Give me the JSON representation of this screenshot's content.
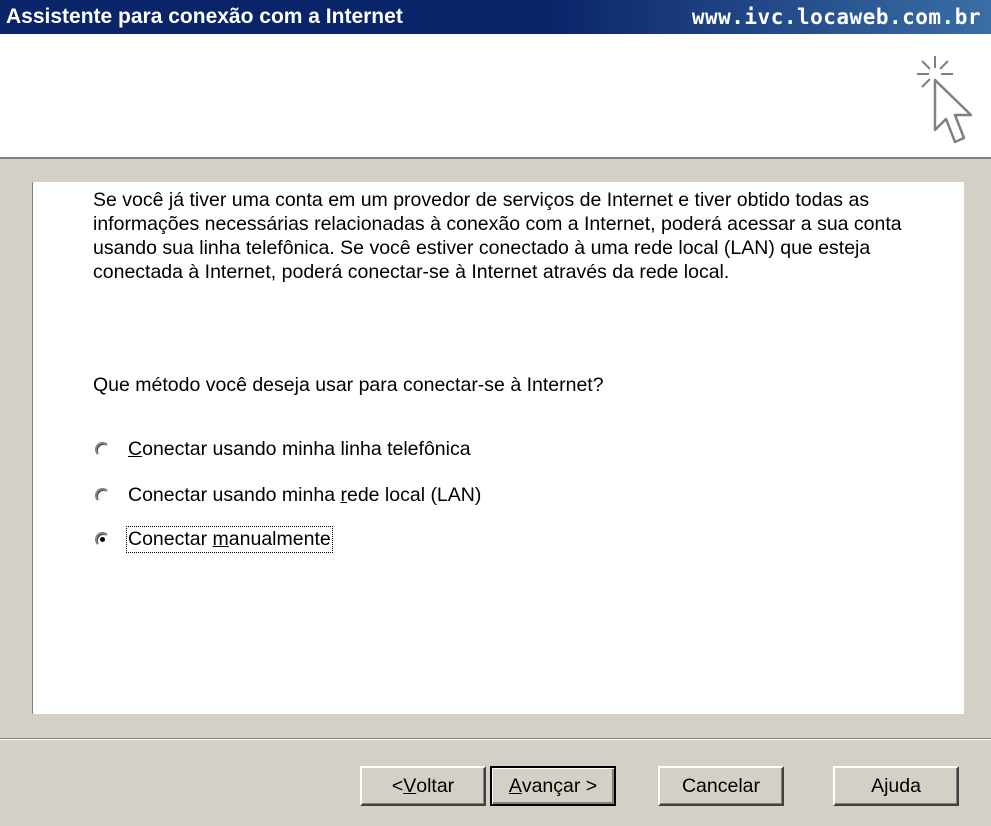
{
  "window": {
    "title": "Assistente para conexão com a Internet",
    "url": "www.ivc.locaweb.com.br"
  },
  "header": {
    "icon": "wizard-pointer-icon"
  },
  "content": {
    "intro": "Se você já tiver uma conta em um provedor de serviços de Internet e tiver obtido todas as informações necessárias relacionadas à conexão com a  Internet, poderá acessar a sua conta usando sua linha telefônica. Se você estiver conectado à uma rede local (LAN) que esteja conectada à Internet, poderá conectar-se à Internet através da rede local.",
    "question": "Que método você deseja usar para conectar-se à Internet?",
    "options": [
      {
        "pre": "",
        "u": "C",
        "post": "onectar usando minha linha telefônica",
        "checked": false
      },
      {
        "pre": "Conectar usando minha ",
        "u": "r",
        "post": "ede local (LAN)",
        "checked": false
      },
      {
        "pre": "Conectar ",
        "u": "m",
        "post": "anualmente",
        "checked": true
      }
    ]
  },
  "buttons": {
    "back": {
      "pre": "< ",
      "u": "V",
      "post": "oltar"
    },
    "next": {
      "pre": "",
      "u": "A",
      "post": "vançar >"
    },
    "cancel": "Cancelar",
    "help": "Ajuda"
  }
}
